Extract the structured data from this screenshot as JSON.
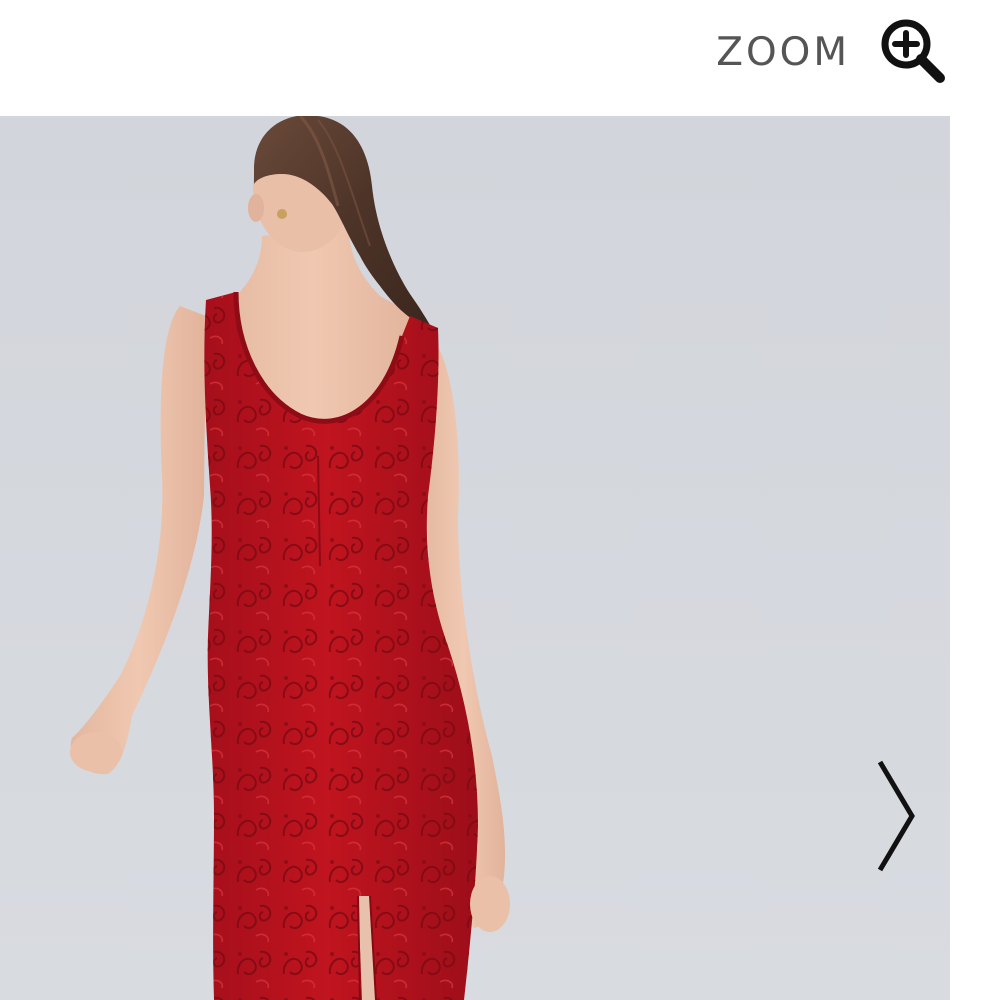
{
  "header": {
    "zoom_label": "ZOOM",
    "zoom_icon": "zoom-in-icon"
  },
  "gallery": {
    "image": "product-photo-red-lace-dress-back-view",
    "next_icon": "chevron-right-icon"
  },
  "colors": {
    "background": "#ffffff",
    "photo_backdrop": "#d5d8de",
    "dress_red": "#b4121f",
    "zoom_text": "#555555",
    "icon": "#111111"
  }
}
